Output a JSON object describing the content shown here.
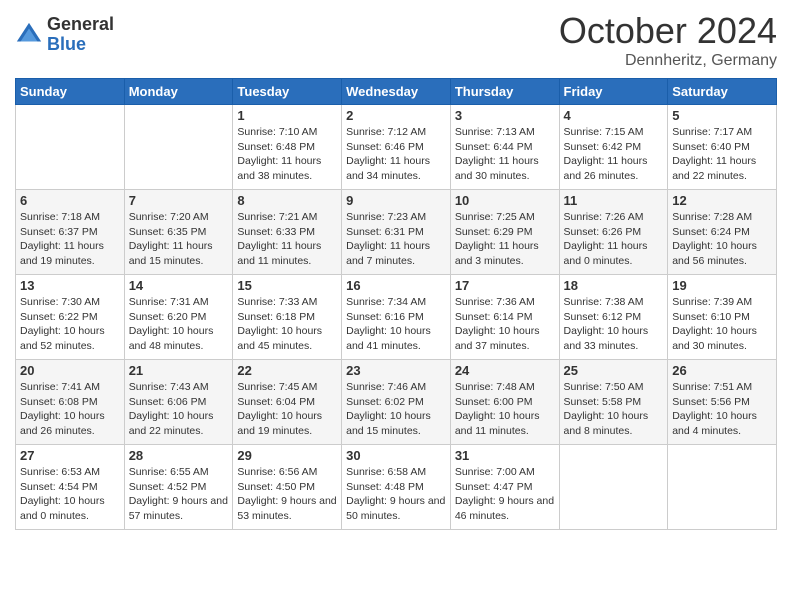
{
  "header": {
    "logo_general": "General",
    "logo_blue": "Blue",
    "month_year": "October 2024",
    "location": "Dennheritz, Germany"
  },
  "calendar": {
    "days_of_week": [
      "Sunday",
      "Monday",
      "Tuesday",
      "Wednesday",
      "Thursday",
      "Friday",
      "Saturday"
    ],
    "weeks": [
      [
        {
          "day": "",
          "info": ""
        },
        {
          "day": "",
          "info": ""
        },
        {
          "day": "1",
          "info": "Sunrise: 7:10 AM\nSunset: 6:48 PM\nDaylight: 11 hours and 38 minutes."
        },
        {
          "day": "2",
          "info": "Sunrise: 7:12 AM\nSunset: 6:46 PM\nDaylight: 11 hours and 34 minutes."
        },
        {
          "day": "3",
          "info": "Sunrise: 7:13 AM\nSunset: 6:44 PM\nDaylight: 11 hours and 30 minutes."
        },
        {
          "day": "4",
          "info": "Sunrise: 7:15 AM\nSunset: 6:42 PM\nDaylight: 11 hours and 26 minutes."
        },
        {
          "day": "5",
          "info": "Sunrise: 7:17 AM\nSunset: 6:40 PM\nDaylight: 11 hours and 22 minutes."
        }
      ],
      [
        {
          "day": "6",
          "info": "Sunrise: 7:18 AM\nSunset: 6:37 PM\nDaylight: 11 hours and 19 minutes."
        },
        {
          "day": "7",
          "info": "Sunrise: 7:20 AM\nSunset: 6:35 PM\nDaylight: 11 hours and 15 minutes."
        },
        {
          "day": "8",
          "info": "Sunrise: 7:21 AM\nSunset: 6:33 PM\nDaylight: 11 hours and 11 minutes."
        },
        {
          "day": "9",
          "info": "Sunrise: 7:23 AM\nSunset: 6:31 PM\nDaylight: 11 hours and 7 minutes."
        },
        {
          "day": "10",
          "info": "Sunrise: 7:25 AM\nSunset: 6:29 PM\nDaylight: 11 hours and 3 minutes."
        },
        {
          "day": "11",
          "info": "Sunrise: 7:26 AM\nSunset: 6:26 PM\nDaylight: 11 hours and 0 minutes."
        },
        {
          "day": "12",
          "info": "Sunrise: 7:28 AM\nSunset: 6:24 PM\nDaylight: 10 hours and 56 minutes."
        }
      ],
      [
        {
          "day": "13",
          "info": "Sunrise: 7:30 AM\nSunset: 6:22 PM\nDaylight: 10 hours and 52 minutes."
        },
        {
          "day": "14",
          "info": "Sunrise: 7:31 AM\nSunset: 6:20 PM\nDaylight: 10 hours and 48 minutes."
        },
        {
          "day": "15",
          "info": "Sunrise: 7:33 AM\nSunset: 6:18 PM\nDaylight: 10 hours and 45 minutes."
        },
        {
          "day": "16",
          "info": "Sunrise: 7:34 AM\nSunset: 6:16 PM\nDaylight: 10 hours and 41 minutes."
        },
        {
          "day": "17",
          "info": "Sunrise: 7:36 AM\nSunset: 6:14 PM\nDaylight: 10 hours and 37 minutes."
        },
        {
          "day": "18",
          "info": "Sunrise: 7:38 AM\nSunset: 6:12 PM\nDaylight: 10 hours and 33 minutes."
        },
        {
          "day": "19",
          "info": "Sunrise: 7:39 AM\nSunset: 6:10 PM\nDaylight: 10 hours and 30 minutes."
        }
      ],
      [
        {
          "day": "20",
          "info": "Sunrise: 7:41 AM\nSunset: 6:08 PM\nDaylight: 10 hours and 26 minutes."
        },
        {
          "day": "21",
          "info": "Sunrise: 7:43 AM\nSunset: 6:06 PM\nDaylight: 10 hours and 22 minutes."
        },
        {
          "day": "22",
          "info": "Sunrise: 7:45 AM\nSunset: 6:04 PM\nDaylight: 10 hours and 19 minutes."
        },
        {
          "day": "23",
          "info": "Sunrise: 7:46 AM\nSunset: 6:02 PM\nDaylight: 10 hours and 15 minutes."
        },
        {
          "day": "24",
          "info": "Sunrise: 7:48 AM\nSunset: 6:00 PM\nDaylight: 10 hours and 11 minutes."
        },
        {
          "day": "25",
          "info": "Sunrise: 7:50 AM\nSunset: 5:58 PM\nDaylight: 10 hours and 8 minutes."
        },
        {
          "day": "26",
          "info": "Sunrise: 7:51 AM\nSunset: 5:56 PM\nDaylight: 10 hours and 4 minutes."
        }
      ],
      [
        {
          "day": "27",
          "info": "Sunrise: 6:53 AM\nSunset: 4:54 PM\nDaylight: 10 hours and 0 minutes."
        },
        {
          "day": "28",
          "info": "Sunrise: 6:55 AM\nSunset: 4:52 PM\nDaylight: 9 hours and 57 minutes."
        },
        {
          "day": "29",
          "info": "Sunrise: 6:56 AM\nSunset: 4:50 PM\nDaylight: 9 hours and 53 minutes."
        },
        {
          "day": "30",
          "info": "Sunrise: 6:58 AM\nSunset: 4:48 PM\nDaylight: 9 hours and 50 minutes."
        },
        {
          "day": "31",
          "info": "Sunrise: 7:00 AM\nSunset: 4:47 PM\nDaylight: 9 hours and 46 minutes."
        },
        {
          "day": "",
          "info": ""
        },
        {
          "day": "",
          "info": ""
        }
      ]
    ]
  }
}
